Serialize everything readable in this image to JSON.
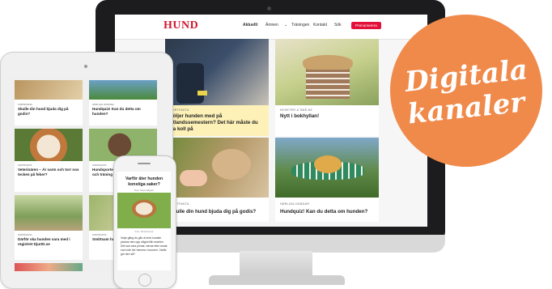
{
  "site": {
    "logo": "HUND",
    "nav": [
      "Aktuellt",
      "Ämnen",
      "Träningen",
      "Kontakt",
      "Sök"
    ],
    "subscribe": "Prenumerera"
  },
  "desktop_cards": [
    {
      "tag": "KORTFAKTA",
      "headline": "Följer hunden med på utlandssemestern? Det här måste du ha koll på"
    },
    {
      "tag": "NYHETER & SMÅ NE",
      "headline": "Nytt i bokhyllan!"
    },
    {
      "tag": "KORTFAKTA",
      "headline": "Skulle din hund bjuda dig på godis?"
    },
    {
      "tag": "HÄRLIGA HUNDAR",
      "headline": "Hundquiz! Kan du detta om hunden?"
    }
  ],
  "tablet_cards": [
    {
      "tag": "FORSKNING",
      "headline": "Skulle din hund bjuda dig på godis?"
    },
    {
      "tag": "HÄRLIGA HUNDAR",
      "headline": "Hundquiz! Kan du detta om hunden?"
    },
    {
      "tag": "KORTFAKTA",
      "headline": "Veterinären – Är varm och torr nos tecken på feber?"
    },
    {
      "tag": "KORTFAKTA",
      "headline": "Hundsporter – Att ha aktivering och träning"
    },
    {
      "tag": "KORTFAKTA",
      "headline": "Därför ska hunden vara med i registret DjurID.se"
    },
    {
      "tag": "KORTFAKTA",
      "headline": "Smittsam hundar"
    }
  ],
  "phone": {
    "title": "Varför äter hunden konstiga saker?",
    "byline": "Text: Cia Lindgren",
    "caption": "Foto: Shutterstock",
    "body": "Varje gång du går ut med hunden plockar den upp något från marken. Det kan vara pinnar, stenar eller annat som inte hör hemma i munnen. Varför gör den så?"
  },
  "badge": {
    "line1": "Digitala",
    "line2": "kanaler"
  },
  "colors": {
    "brand": "#d0182f",
    "badge": "#f08a4b",
    "highlight": "#fdf1b8"
  }
}
